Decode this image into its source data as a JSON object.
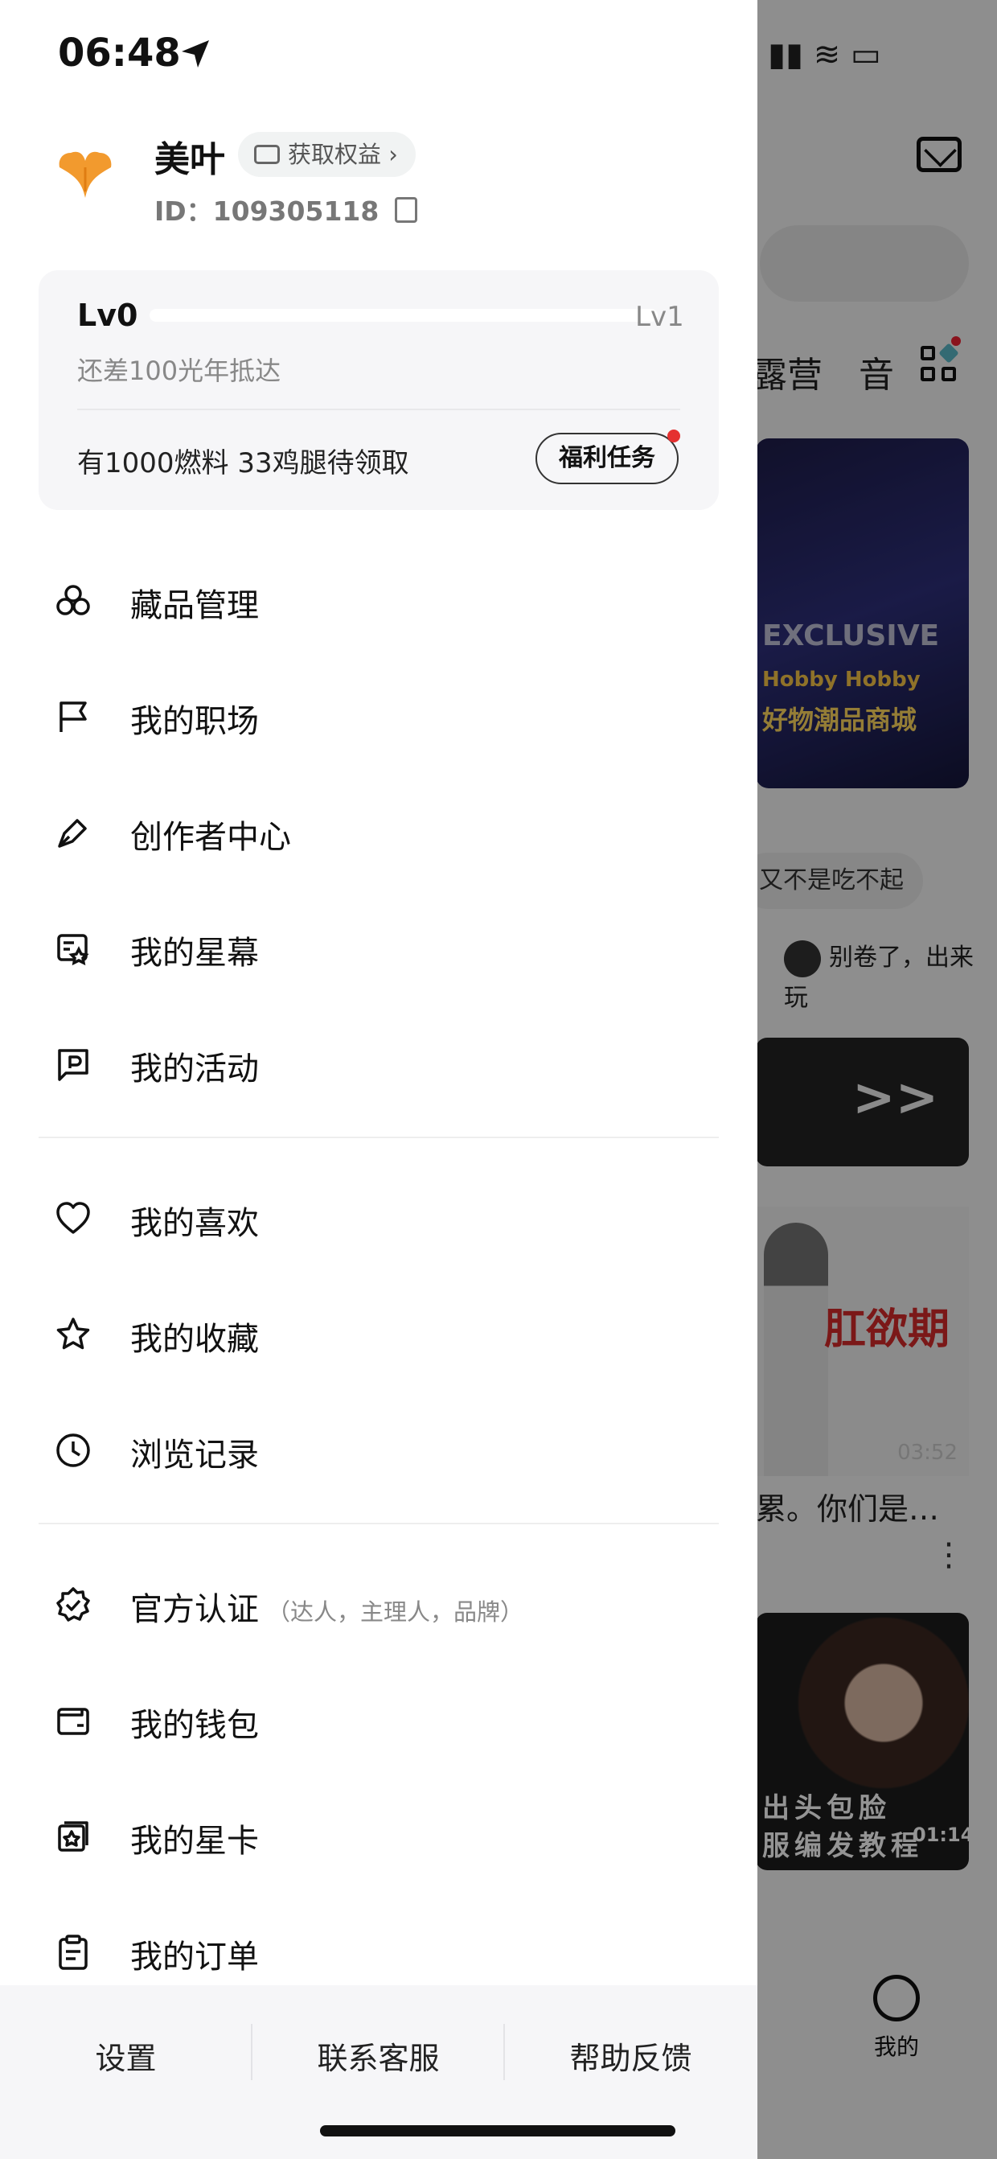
{
  "status_bar": {
    "time": "06:48"
  },
  "profile": {
    "name": "美叶",
    "benefit_label": "获取权益 ›",
    "id_label": "ID：",
    "id_value": "109305118"
  },
  "level": {
    "current": "Lv0",
    "next": "Lv1",
    "progress": 0,
    "note": "还差100光年抵达",
    "rewards": "有1000燃料 33鸡腿待领取",
    "task_button": "福利任务"
  },
  "menu_group1": [
    {
      "label": "藏品管理",
      "icon": "collection-icon"
    },
    {
      "label": "我的职场",
      "icon": "flag-icon"
    },
    {
      "label": "创作者中心",
      "icon": "pen-icon"
    },
    {
      "label": "我的星幕",
      "icon": "star-screen-icon"
    },
    {
      "label": "我的活动",
      "icon": "activity-icon"
    }
  ],
  "menu_group2": [
    {
      "label": "我的喜欢",
      "icon": "heart-icon"
    },
    {
      "label": "我的收藏",
      "icon": "star-icon"
    },
    {
      "label": "浏览记录",
      "icon": "clock-icon"
    }
  ],
  "menu_group3": [
    {
      "label": "官方认证",
      "sub": "（达人，主理人，品牌）",
      "icon": "verified-icon"
    },
    {
      "label": "我的钱包",
      "icon": "wallet-icon"
    },
    {
      "label": "我的星卡",
      "icon": "star-card-icon"
    },
    {
      "label": "我的订单",
      "icon": "clipboard-icon"
    }
  ],
  "bottom_bar": {
    "settings": "设置",
    "contact": "联系客服",
    "help": "帮助反馈"
  },
  "background": {
    "tab_1": "露营",
    "tab_2": "音",
    "banner_text_1": "EXCLUSIVE",
    "banner_text_2": "Hobby Hobby",
    "banner_text_3": "好物潮品商城",
    "chip_1": "又不是吃不起",
    "message": "别卷了，出来玩",
    "video_arrows": ">>",
    "card_title": "肛欲期",
    "card_duration": "03:52",
    "card_caption": "累。你们是…",
    "card3_line1": "出头包脸",
    "card3_line2": "服编发教程",
    "card3_duration": "01:14",
    "me_tab": "我的"
  },
  "colors": {
    "accent": "#f29a2e",
    "dot": "#e53030",
    "overlay": "rgba(0,0,0,0.42)"
  }
}
